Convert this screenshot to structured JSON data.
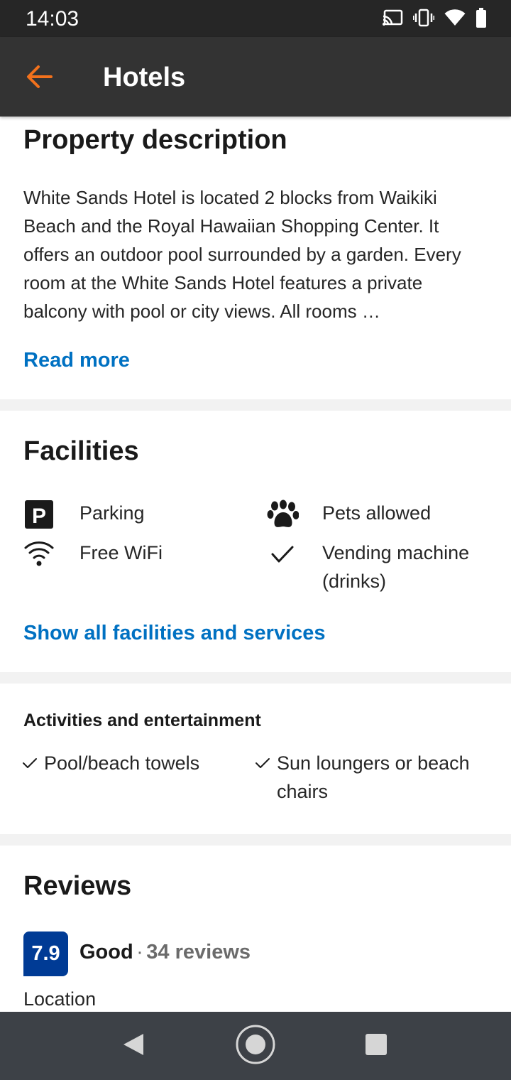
{
  "status_bar": {
    "time": "14:03",
    "icons": [
      "cast-icon",
      "vibrate-icon",
      "wifi-icon",
      "battery-icon"
    ]
  },
  "app_bar": {
    "title": "Hotels",
    "back_icon": "arrow-left-icon",
    "accent_color": "#f2711c"
  },
  "property_description": {
    "heading": "Property description",
    "text": "White Sands Hotel is located 2 blocks from Waikiki Beach and the Royal Hawaiian Shopping Center. It offers an outdoor pool surrounded by a garden. Every room at the White Sands Hotel features a private balcony with pool or city views. All rooms …",
    "read_more": "Read more"
  },
  "facilities": {
    "heading": "Facilities",
    "items": [
      {
        "label": "Parking",
        "icon": "parking-icon"
      },
      {
        "label": "Pets allowed",
        "icon": "paw-icon"
      },
      {
        "label": "Free WiFi",
        "icon": "wifi-icon"
      },
      {
        "label": "Vending machine (drinks)",
        "icon": "checkmark-icon"
      }
    ],
    "show_all": "Show all facilities and services"
  },
  "activities": {
    "heading": "Activities and entertainment",
    "items": [
      {
        "label": "Pool/beach towels",
        "icon": "checkmark-icon"
      },
      {
        "label": "Sun loungers or beach chairs",
        "icon": "checkmark-icon"
      }
    ]
  },
  "reviews": {
    "heading": "Reviews",
    "score": "7.9",
    "rating_word": "Good",
    "separator": "·",
    "count": "34 reviews",
    "category": "Location",
    "badge_color": "#003b95"
  },
  "link_color": "#0071c2",
  "nav_bar": {
    "buttons": [
      "back-triangle-icon",
      "home-circle-icon",
      "recents-square-icon"
    ]
  }
}
